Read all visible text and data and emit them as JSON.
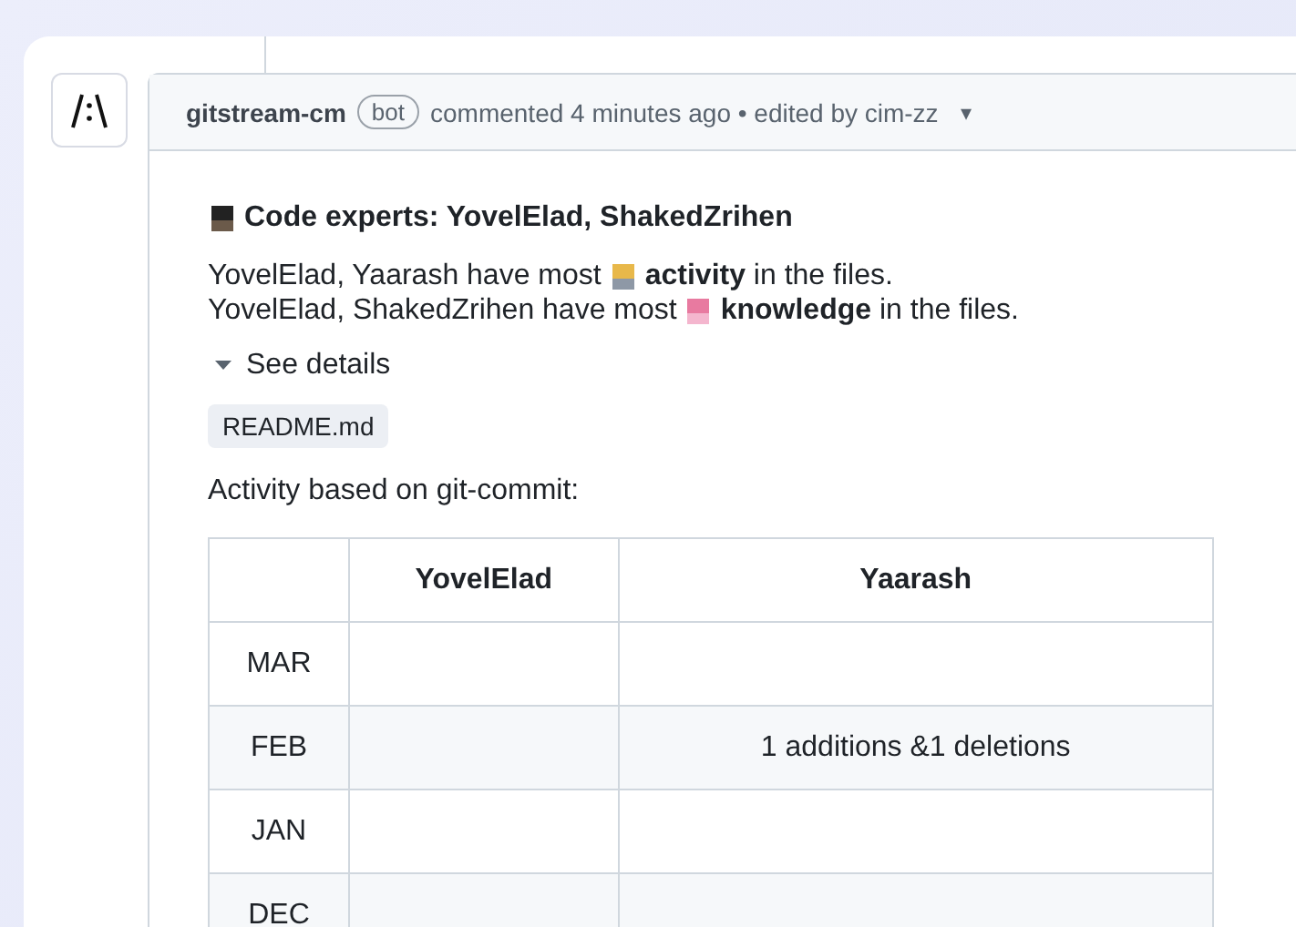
{
  "comment": {
    "author": "gitstream-cm",
    "badge": "bot",
    "meta": "commented 4 minutes ago • edited by cim-zz",
    "menu_caret": "▾"
  },
  "body": {
    "heading": "Code experts: YovelElad, ShakedZrihen",
    "lines": [
      {
        "kind": "activity",
        "before": "YovelElad, Yaarash have most",
        "after": "**activity** in the files."
      },
      {
        "kind": "knowledge",
        "before": "YovelElad, ShakedZrihen have most",
        "after": "**knowledge** in the files."
      }
    ],
    "details": {
      "label": "See details",
      "expanded": true
    },
    "file": "README.md",
    "caption": "Activity based on git-commit:"
  },
  "table": {
    "columns": [
      "",
      "YovelElad",
      "Yaarash"
    ],
    "rows": [
      [
        "MAR",
        "",
        ""
      ],
      [
        "FEB",
        "",
        "1 additions &1 deletions"
      ],
      [
        "JAN",
        "",
        ""
      ],
      [
        "DEC",
        "",
        ""
      ]
    ]
  }
}
